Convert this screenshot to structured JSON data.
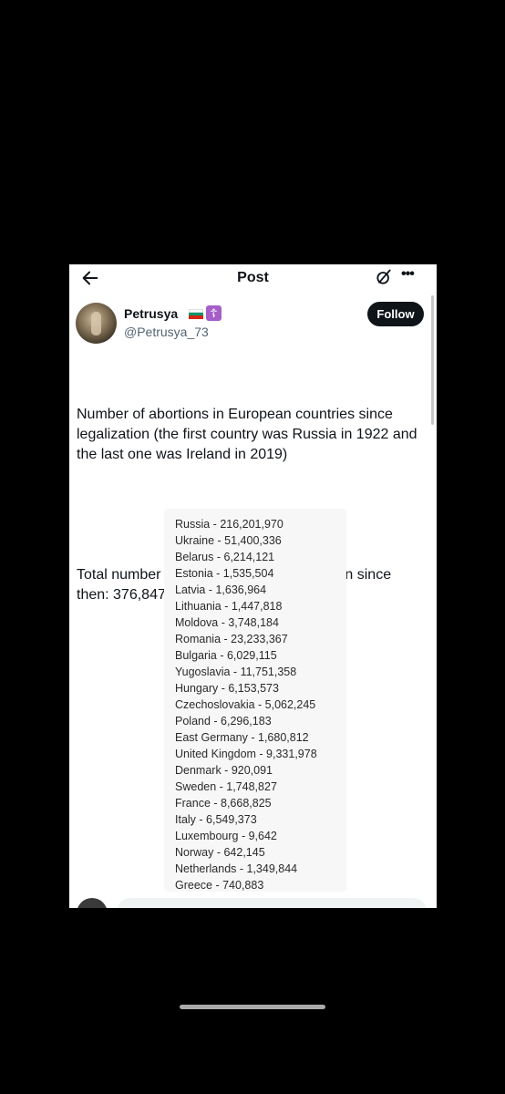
{
  "header": {
    "title": "Post"
  },
  "author": {
    "display_name": "Petrusya",
    "handle": "@Petrusya_73",
    "badge_icon": "orthodox-cross-icon",
    "flag_colors": [
      "#ffffff",
      "#00966e",
      "#d62612"
    ]
  },
  "follow_label": "Follow",
  "post": {
    "paragraph1": "Number of abortions in European countries since legalization (the first country was Russia in 1922 and the last one was Ireland in 2019)",
    "paragraph2": "Total number of aborted European children since then: 376,847,034...."
  },
  "countries": [
    "Russia - 216,201,970",
    "Ukraine - 51,400,336",
    "Belarus - 6,214,121",
    "Estonia - 1,535,504",
    "Latvia - 1,636,964",
    "Lithuania - 1,447,818",
    "Moldova - 3,748,184",
    "Romania - 23,233,367",
    "Bulgaria - 6,029,115",
    "Yugoslavia - 11,751,358",
    "Hungary - 6,153,573",
    "Czechoslovakia - 5,062,245",
    "Poland - 6,296,183",
    "East Germany - 1,680,812",
    "United Kingdom - 9,331,978",
    "Denmark - 920,091",
    "Sweden - 1,748,827",
    "France - 8,668,825",
    "Italy - 6,549,373",
    "Luxembourg - 9,642",
    "Norway - 642,145",
    "Netherlands - 1,349,844",
    "Greece - 740,883"
  ]
}
